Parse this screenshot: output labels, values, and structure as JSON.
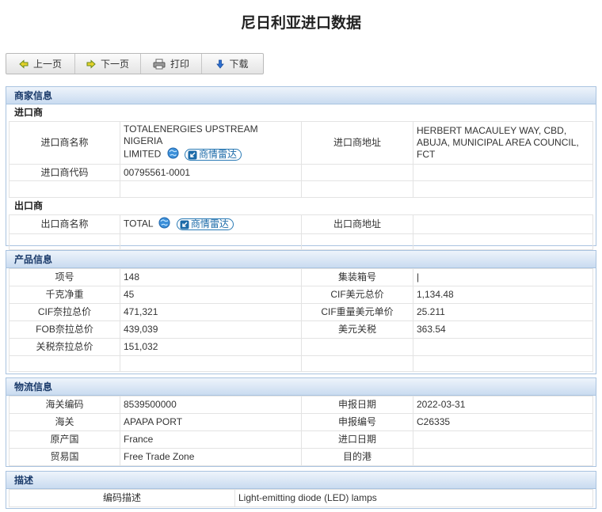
{
  "page": {
    "title": "尼日利亚进口数据"
  },
  "toolbar": {
    "prev_label": "上一页",
    "next_label": "下一页",
    "print_label": "打印",
    "download_label": "下载"
  },
  "merchant": {
    "section_title": "商家信息",
    "importer_title": "进口商",
    "importer_name_label": "进口商名称",
    "importer_name_line1": "TOTALENERGIES UPSTREAM NIGERIA",
    "importer_name_line2": "LIMITED",
    "importer_address_label": "进口商地址",
    "importer_address": "HERBERT MACAULEY WAY, CBD, ABUJA, MUNICIPAL AREA COUNCIL, FCT",
    "importer_code_label": "进口商代码",
    "importer_code": "00795561-0001",
    "radar_label": "商情雷达",
    "exporter_title": "出口商",
    "exporter_name_label": "出口商名称",
    "exporter_name": "TOTAL",
    "exporter_address_label": "出口商地址"
  },
  "product": {
    "section_title": "产品信息",
    "item_no_label": "项号",
    "item_no": "148",
    "container_label": "集装箱号",
    "container": "|",
    "net_weight_label": "千克净重",
    "net_weight": "45",
    "cif_usd_total_label": "CIF美元总价",
    "cif_usd_total": "1,134.48",
    "cif_naira_total_label": "CIF奈拉总价",
    "cif_naira_total": "471,321",
    "cif_usd_unit_label": "CIF重量美元单价",
    "cif_usd_unit": "25.211",
    "fob_naira_total_label": "FOB奈拉总价",
    "fob_naira_total": "439,039",
    "usd_tariff_label": "美元关税",
    "usd_tariff": "363.54",
    "tariff_naira_total_label": "关税奈拉总价",
    "tariff_naira_total": "151,032"
  },
  "logistics": {
    "section_title": "物流信息",
    "hs_code_label": "海关编码",
    "hs_code": "8539500000",
    "declare_date_label": "申报日期",
    "declare_date": "2022-03-31",
    "customs_label": "海关",
    "customs": "APAPA PORT",
    "declare_no_label": "申报编号",
    "declare_no": "C26335",
    "origin_label": "原产国",
    "origin": "France",
    "import_date_label": "进口日期",
    "trade_country_label": "贸易国",
    "trade_country": "Free Trade Zone",
    "dest_port_label": "目的港"
  },
  "description": {
    "section_title": "描述",
    "code_desc_label": "编码描述",
    "code_desc": "Light-emitting diode (LED) lamps"
  },
  "colors": {
    "section_border": "#a9c3e0",
    "section_header_text": "#1a3a6a",
    "radar_blue": "#1b6aa8"
  },
  "icons": {
    "prev": "arrow-left-icon",
    "next": "arrow-right-icon",
    "print": "printer-icon",
    "download": "arrow-down-icon",
    "globe": "globe-icon",
    "radar": "radar-arrow-icon"
  }
}
